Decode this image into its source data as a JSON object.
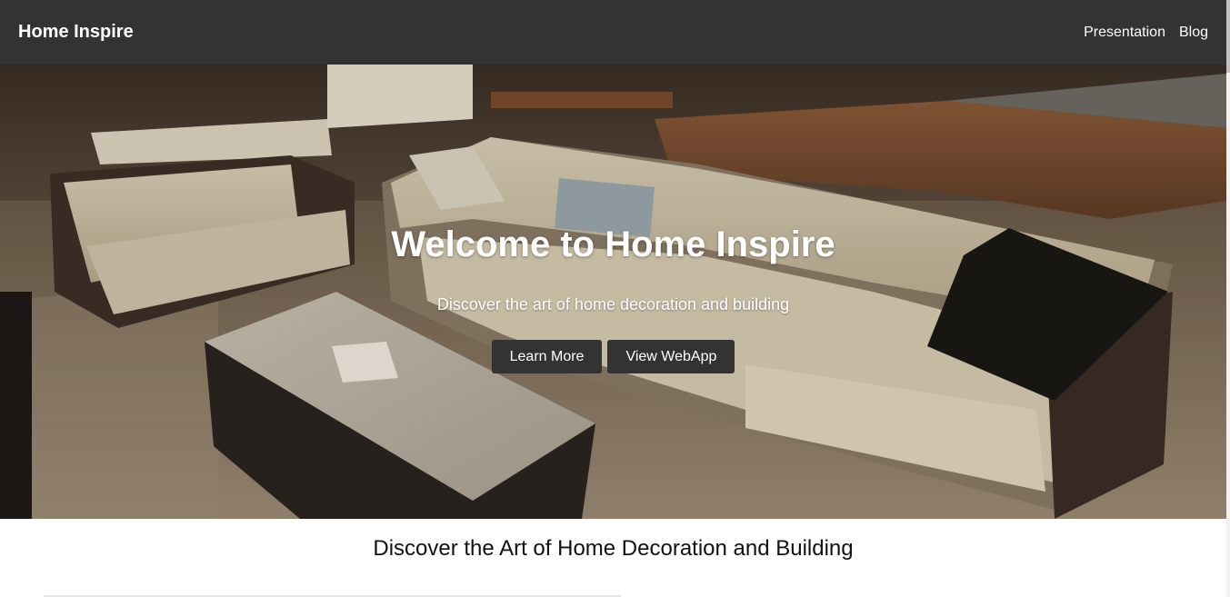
{
  "navbar": {
    "brand": "Home Inspire",
    "links": [
      "Presentation",
      "Blog"
    ]
  },
  "hero": {
    "title": "Welcome to Home Inspire",
    "subtitle": "Discover the art of home decoration and building",
    "buttons": [
      "Learn More",
      "View WebApp"
    ]
  },
  "section": {
    "heading": "Discover the Art of Home Decoration and Building"
  },
  "colors": {
    "navbar_bg": "#333333",
    "button_bg": "#333333",
    "text_light": "#ffffff"
  }
}
